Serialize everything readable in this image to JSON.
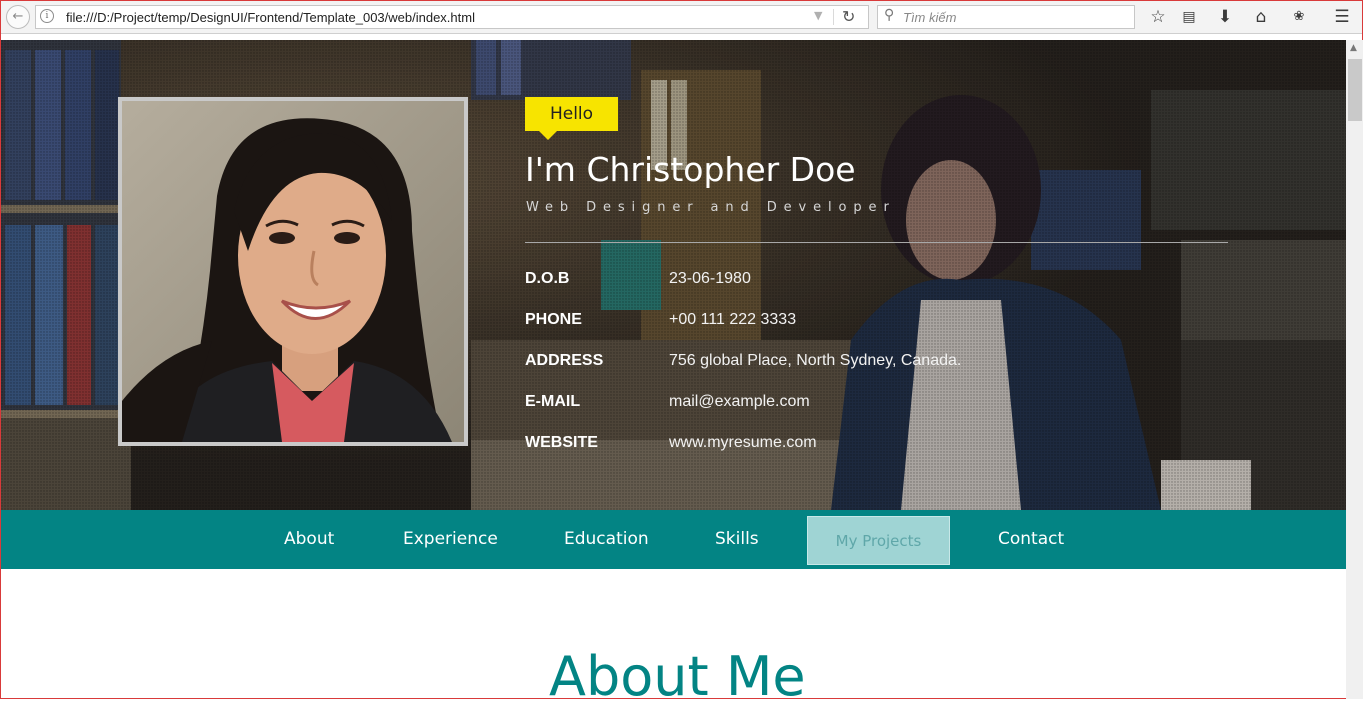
{
  "browser": {
    "url": "file:///D:/Project/temp/DesignUI/Frontend/Template_003/web/index.html",
    "search_placeholder": "Tìm kiếm",
    "icons": [
      "back-icon",
      "info-icon",
      "dropdown-icon",
      "reload-icon",
      "search-icon",
      "bookmark-star-icon",
      "reader-list-icon",
      "download-icon",
      "home-icon",
      "addon-icon",
      "hamburger-menu-icon"
    ]
  },
  "profile": {
    "greeting": "Hello",
    "name": "I'm Christopher Doe",
    "role": "Web Designer and Developer",
    "details": [
      {
        "label": "D.O.B",
        "value": "23-06-1980"
      },
      {
        "label": "PHONE",
        "value": "+00 111 222 3333"
      },
      {
        "label": "ADDRESS",
        "value": "756 global Place, North Sydney, Canada."
      },
      {
        "label": "E-MAIL",
        "value": "mail@example.com"
      },
      {
        "label": "WEBSITE",
        "value": "www.myresume.com"
      }
    ]
  },
  "menu": {
    "items": [
      {
        "label": "About"
      },
      {
        "label": "Experience"
      },
      {
        "label": "Education"
      },
      {
        "label": "Skills"
      },
      {
        "label": "My Projects",
        "active": true
      },
      {
        "label": "Contact"
      }
    ]
  },
  "about": {
    "title": "About Me"
  },
  "colors": {
    "teal": "#038484",
    "highlight": "#f7e400",
    "active_tab_bg": "#9fd4d4"
  }
}
